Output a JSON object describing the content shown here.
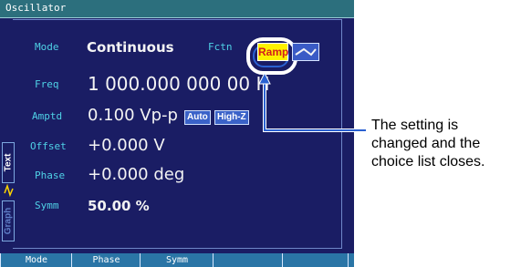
{
  "window": {
    "title": "Oscillator"
  },
  "params": [
    {
      "label": "Mode",
      "value": "Continuous"
    },
    {
      "label": "Freq",
      "value": "1 000.000 000 00 H"
    },
    {
      "label": "Amptd",
      "value": "0.100 Vp-p"
    },
    {
      "label": "Offset",
      "value": "+0.000 V"
    },
    {
      "label": "Phase",
      "value": "+0.000 deg"
    },
    {
      "label": "Symm",
      "value": "50.00 %"
    }
  ],
  "function": {
    "label": "Fctn",
    "selected": "Ramp"
  },
  "amplitude_badges": [
    "Auto",
    "High-Z"
  ],
  "side_tabs": [
    "Text",
    "Graph"
  ],
  "softkeys": [
    "Mode",
    "Phase",
    "Symm",
    "",
    "",
    ""
  ],
  "callout": "The setting is changed and the choice list closes.",
  "colors": {
    "label": "#4fd1e6",
    "accent": "#2a61d1",
    "ramp": "#d31d1d"
  }
}
